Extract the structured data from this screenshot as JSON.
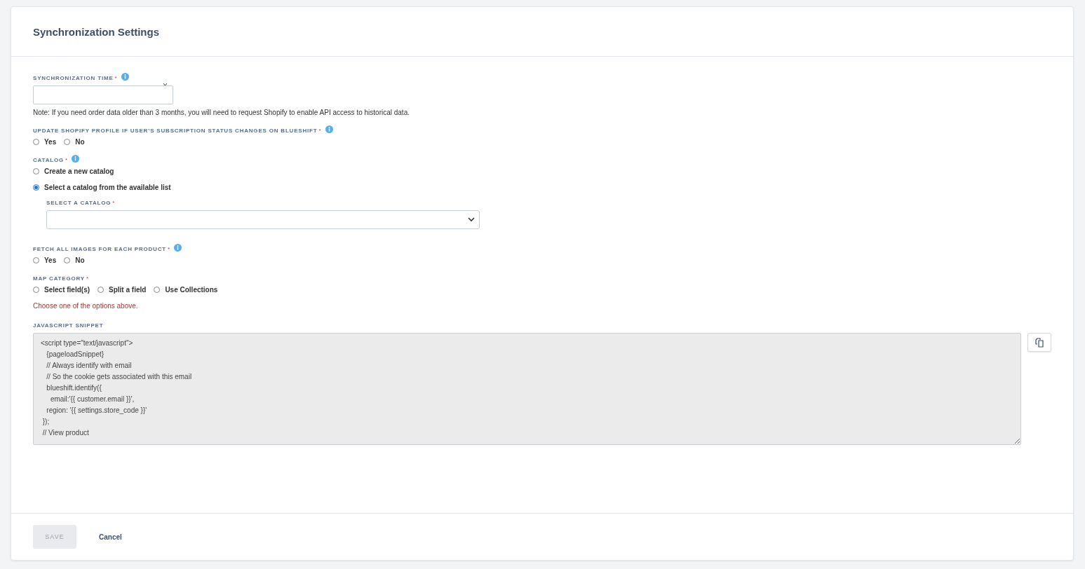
{
  "title": "Synchronization Settings",
  "sync_time": {
    "label": "SYNCHRONIZATION TIME",
    "required_mark": "*",
    "info": true,
    "note": "Note:  If you need order data older than 3 months, you will need to request Shopify to enable API access to historical data."
  },
  "update_profile": {
    "label": "UPDATE SHOPIFY PROFILE IF USER’S SUBSCRIPTION STATUS CHANGES ON BLUESHIFT",
    "required_mark": "*",
    "info": true,
    "options": [
      {
        "label": "Yes",
        "selected": false
      },
      {
        "label": "No",
        "selected": false
      }
    ]
  },
  "catalog": {
    "label": "CATALOG",
    "required_mark": "*",
    "info": true,
    "options": [
      {
        "label": "Create a new catalog",
        "selected": false
      },
      {
        "label": "Select a catalog from the available list",
        "selected": true
      }
    ],
    "select": {
      "label": "SELECT A CATALOG",
      "required_mark": "*"
    }
  },
  "fetch_images": {
    "label": "FETCH ALL IMAGES FOR EACH PRODUCT",
    "required_mark": "*",
    "info": true,
    "options": [
      {
        "label": "Yes",
        "selected": false
      },
      {
        "label": "No",
        "selected": false
      }
    ]
  },
  "map_category": {
    "label": "MAP CATEGORY",
    "required_mark": "*",
    "options": [
      {
        "label": "Select field(s)",
        "selected": false
      },
      {
        "label": "Split a field",
        "selected": false
      },
      {
        "label": "Use Collections",
        "selected": false
      }
    ],
    "error": "Choose one of the options above."
  },
  "snippet": {
    "label": "JAVASCRIPT SNIPPET",
    "lines": [
      "<script type=\"text/javascript\">",
      "   {pageloadSnippet}",
      "   // Always identify with email",
      "   // So the cookie gets associated with this email",
      "   blueshift.identify({",
      "     email:'{{ customer.email }}',",
      "   region: '{{ settings.store_code }}'",
      " });",
      " // View product"
    ]
  },
  "footer": {
    "save": {
      "label": "SAVE",
      "disabled": true
    },
    "cancel": "Cancel"
  }
}
